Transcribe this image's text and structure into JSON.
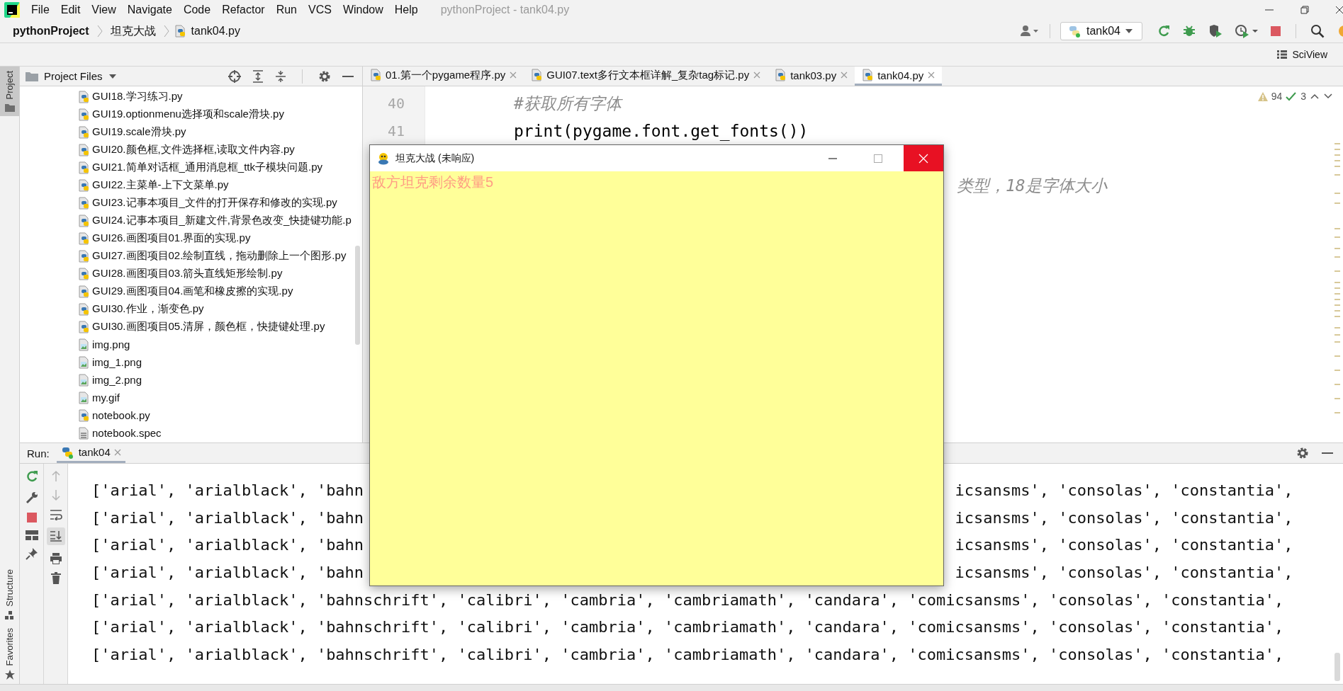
{
  "menu_bar": {
    "items": [
      "File",
      "Edit",
      "View",
      "Navigate",
      "Code",
      "Refactor",
      "Run",
      "VCS",
      "Window",
      "Help"
    ],
    "window_title": "pythonProject - tank04.py"
  },
  "breadcrumbs": [
    {
      "label": "pythonProject",
      "kind": "project"
    },
    {
      "label": "坦克大战",
      "kind": "folder"
    },
    {
      "label": "tank04.py",
      "kind": "file"
    }
  ],
  "run_config": {
    "label": "tank04"
  },
  "sciview": {
    "label": "SciView"
  },
  "side_stripe": {
    "top": [
      {
        "label": "Project",
        "selected": true
      }
    ],
    "bottom": [
      {
        "label": "Structure",
        "kind": "structure"
      },
      {
        "label": "Favorites",
        "kind": "favorites"
      }
    ]
  },
  "project_panel": {
    "title": "Project Files",
    "items": [
      {
        "name": "GUI18.学习练习.py",
        "kind": "python"
      },
      {
        "name": "GUI19.optionmenu选择项和scale滑块.py",
        "kind": "python"
      },
      {
        "name": "GUI19.scale滑块.py",
        "kind": "python"
      },
      {
        "name": "GUI20.颜色框,文件选择框,读取文件内容.py",
        "kind": "python"
      },
      {
        "name": "GUI21.简单对话框_通用消息框_ttk子模块问题.py",
        "kind": "python"
      },
      {
        "name": "GUI22.主菜单-上下文菜单.py",
        "kind": "python"
      },
      {
        "name": "GUI23.记事本项目_文件的打开保存和修改的实现.py",
        "kind": "python"
      },
      {
        "name": "GUI24.记事本项目_新建文件,背景色改变_快捷键功能.p",
        "kind": "python"
      },
      {
        "name": "GUI26.画图项目01.界面的实现.py",
        "kind": "python"
      },
      {
        "name": "GUI27.画图项目02.绘制直线，拖动删除上一个图形.py",
        "kind": "python"
      },
      {
        "name": "GUI28.画图项目03.箭头直线矩形绘制.py",
        "kind": "python"
      },
      {
        "name": "GUI29.画图项目04.画笔和橡皮擦的实现.py",
        "kind": "python"
      },
      {
        "name": "GUI30.作业，渐变色.py",
        "kind": "python"
      },
      {
        "name": "GUI30.画图项目05.清屏，颜色框，快捷键处理.py",
        "kind": "python"
      },
      {
        "name": "img.png",
        "kind": "image"
      },
      {
        "name": "img_1.png",
        "kind": "image"
      },
      {
        "name": "img_2.png",
        "kind": "image"
      },
      {
        "name": "my.gif",
        "kind": "image"
      },
      {
        "name": "notebook.py",
        "kind": "python"
      },
      {
        "name": "notebook.spec",
        "kind": "text"
      }
    ]
  },
  "editor": {
    "tabs": [
      {
        "label": "01.第一个pygame程序.py",
        "selected": false
      },
      {
        "label": "GUI07.text多行文本框详解_复杂tag标记.py",
        "selected": false
      },
      {
        "label": "tank03.py",
        "selected": false
      },
      {
        "label": "tank04.py",
        "selected": true
      }
    ],
    "lines": [
      {
        "number": "40",
        "kind": "comment",
        "text": "#获取所有字体"
      },
      {
        "number": "41",
        "kind": "code",
        "text": "print(pygame.font.get_fonts())"
      }
    ],
    "comment_tail": "类型，18是字体大小",
    "warnings": "94",
    "checks": "3"
  },
  "run_panel": {
    "label": "Run:",
    "tabs": [
      {
        "label": "tank04",
        "selected": true
      }
    ],
    "lines": [
      {
        "left": "['arial', 'arialblack', 'bahn",
        "right": "icsansms', 'consolas', 'constantia',"
      },
      {
        "left": "['arial', 'arialblack', 'bahn",
        "right": "icsansms', 'consolas', 'constantia',"
      },
      {
        "left": "['arial', 'arialblack', 'bahn",
        "right": "icsansms', 'consolas', 'constantia',"
      },
      {
        "left": "['arial', 'arialblack', 'bahn",
        "right": "icsansms', 'consolas', 'constantia',"
      },
      {
        "left": "['arial', 'arialblack', 'bahnschrift', 'calibri', 'cambria', 'cambriamath', 'candara', 'comicsansms', 'consolas', 'constantia',"
      },
      {
        "left": "['arial', 'arialblack', 'bahnschrift', 'calibri', 'cambria', 'cambriamath', 'candara', 'comicsansms', 'consolas', 'constantia',"
      },
      {
        "left": "['arial', 'arialblack', 'bahnschrift', 'calibri', 'cambria', 'cambriamath', 'candara', 'comicsansms', 'consolas', 'constantia',"
      }
    ]
  },
  "popup": {
    "title": "坦克大战 (未响应)",
    "text": "敌方坦克剩余数量5"
  }
}
